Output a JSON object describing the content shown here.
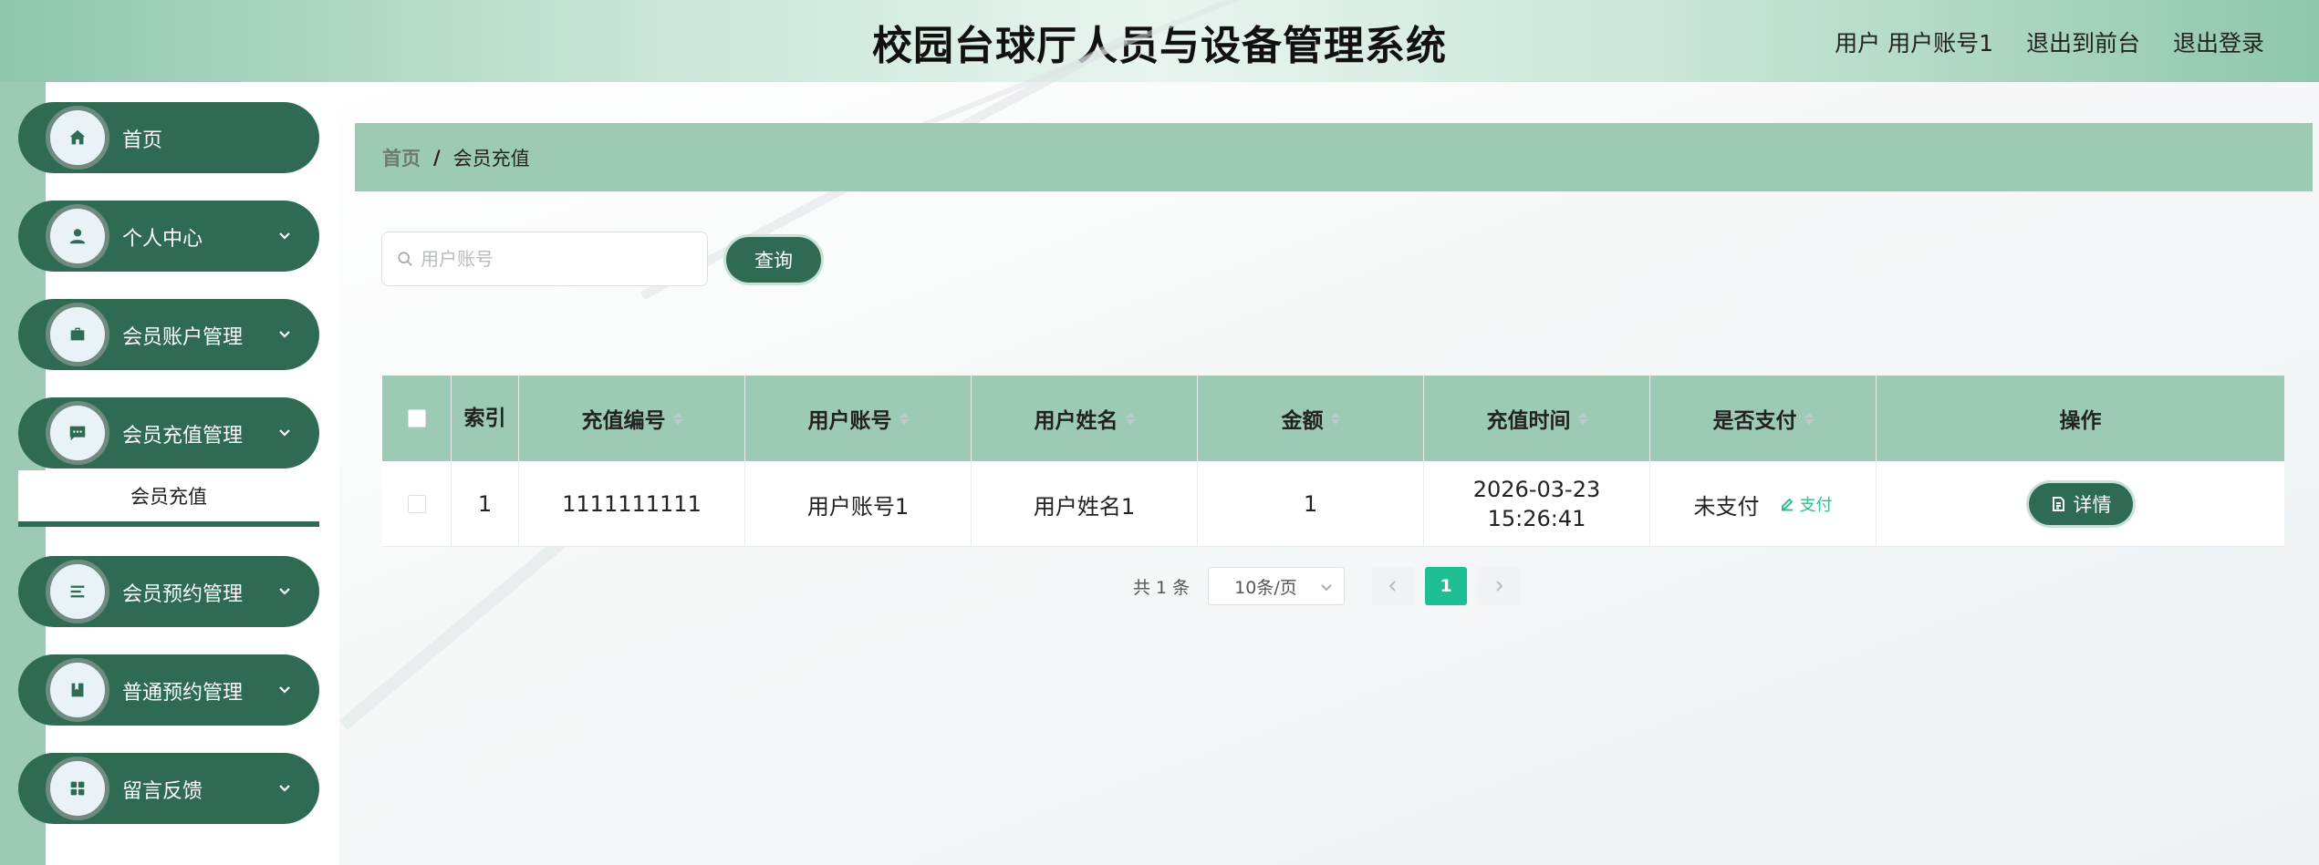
{
  "header": {
    "title": "校园台球厅人员与设备管理系统",
    "user_prefix": "用户",
    "user_name": "用户账号1",
    "back_front": "退出到前台",
    "logout": "退出登录"
  },
  "sidebar": {
    "items": [
      {
        "label": "首页",
        "icon": "home-icon",
        "has_arrow": false
      },
      {
        "label": "个人中心",
        "icon": "user-icon",
        "has_arrow": true
      },
      {
        "label": "会员账户管理",
        "icon": "briefcase-icon",
        "has_arrow": true
      },
      {
        "label": "会员充值管理",
        "icon": "message-icon",
        "has_arrow": true
      },
      {
        "label": "会员预约管理",
        "icon": "list-icon",
        "has_arrow": true
      },
      {
        "label": "普通预约管理",
        "icon": "book-icon",
        "has_arrow": true
      },
      {
        "label": "留言反馈",
        "icon": "grid-icon",
        "has_arrow": true
      }
    ],
    "active_submenu": "会员充值"
  },
  "breadcrumb": {
    "home": "首页",
    "separator": "/",
    "current": "会员充值"
  },
  "search": {
    "placeholder": "用户账号",
    "value": "",
    "button_label": "查询"
  },
  "table": {
    "columns": [
      "",
      "索引",
      "充值编号",
      "用户账号",
      "用户姓名",
      "金额",
      "充值时间",
      "是否支付",
      "操作"
    ],
    "rows": [
      {
        "index": "1",
        "recharge_no": "1111111111",
        "account": "用户账号1",
        "name": "用户姓名1",
        "amount": "1",
        "time": "2026-03-23 15:26:41",
        "paid": "未支付",
        "pay_action": "支付",
        "detail_action": "详情"
      }
    ]
  },
  "pagination": {
    "total_text": "共 1 条",
    "page_size": "10条/页",
    "current_page": "1"
  },
  "colors": {
    "primary": "#2e6b52",
    "header_bg": "#9dcab4",
    "accent": "#1dbf93"
  }
}
